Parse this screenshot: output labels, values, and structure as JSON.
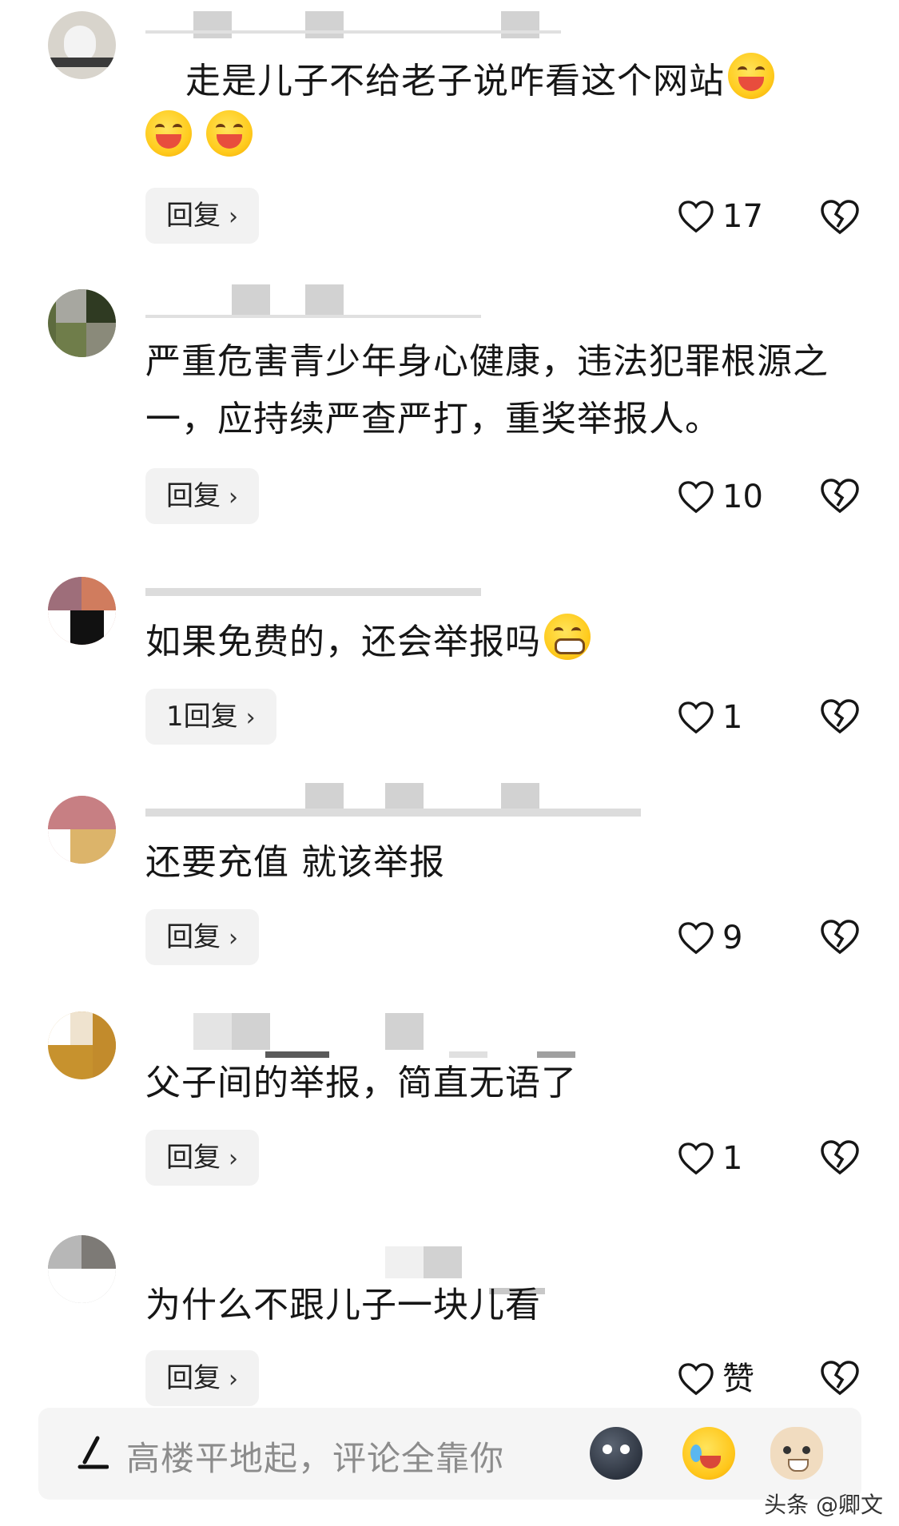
{
  "comments": [
    {
      "text": "走是儿子不给老子说咋看这个网站",
      "reply_label": "回复",
      "likes": "17"
    },
    {
      "text": "严重危害青少年身心健康，违法犯罪根源之一，应持续严查严打，重奖举报人。",
      "reply_label": "回复",
      "likes": "10"
    },
    {
      "text": "如果免费的，还会举报吗",
      "reply_label": "1回复",
      "likes": "1"
    },
    {
      "text": "还要充值 就该举报",
      "reply_label": "回复",
      "likes": "9"
    },
    {
      "text": "父子间的举报，简直无语了",
      "reply_label": "回复",
      "likes": "1"
    },
    {
      "text": "为什么不跟儿子一块儿看",
      "reply_label": "回复",
      "likes": "赞"
    }
  ],
  "chevron": "›",
  "bottom_bar": {
    "placeholder": "高楼平地起，评论全靠你"
  },
  "watermark": "头条 @卿文",
  "icons": {
    "like": "heart-outline-icon",
    "dislike": "broken-heart-icon",
    "pen": "pen-icon",
    "emoji_laugh": "laughing-emoji-icon",
    "emoji_grin": "grinning-emoji-icon",
    "sticker_1": "moon-face-sticker-icon",
    "sticker_2": "crying-laugh-sticker-icon",
    "sticker_3": "cat-face-sticker-icon"
  },
  "colors": {
    "text": "#161616",
    "meta": "#b4b4b4",
    "reply_bg": "#f2f2f2",
    "bar_bg": "#f5f5f5"
  }
}
